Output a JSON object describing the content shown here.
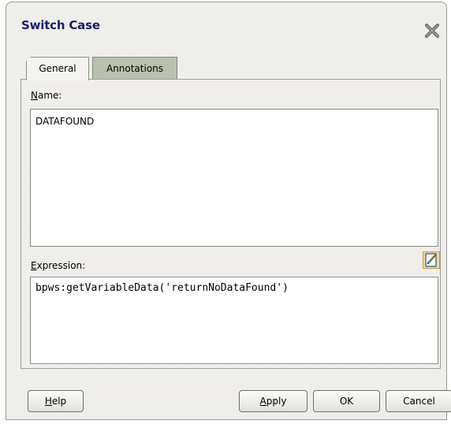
{
  "dialog": {
    "title": "Switch Case",
    "close_icon": "close-icon"
  },
  "tabs": [
    {
      "label": "General",
      "selected": true
    },
    {
      "label": "Annotations",
      "selected": false
    }
  ],
  "form": {
    "name_label_mnemonic": "N",
    "name_label_rest": "ame:",
    "name_value": "DATAFOUND",
    "expression_label_mnemonic": "E",
    "expression_label_rest": "xpression:",
    "expression_value": "bpws:getVariableData('returnNoDataFound')",
    "expression_edit_icon": "edit-expression-icon"
  },
  "buttons": {
    "help_mnemonic": "H",
    "help_rest": "elp",
    "apply_mnemonic": "A",
    "apply_rest": "pply",
    "ok": "OK",
    "cancel": "Cancel"
  },
  "colors": {
    "title": "#1a1c6e",
    "dialog_bg": "#eeede8",
    "inactive_tab": "#b9c0ae"
  }
}
